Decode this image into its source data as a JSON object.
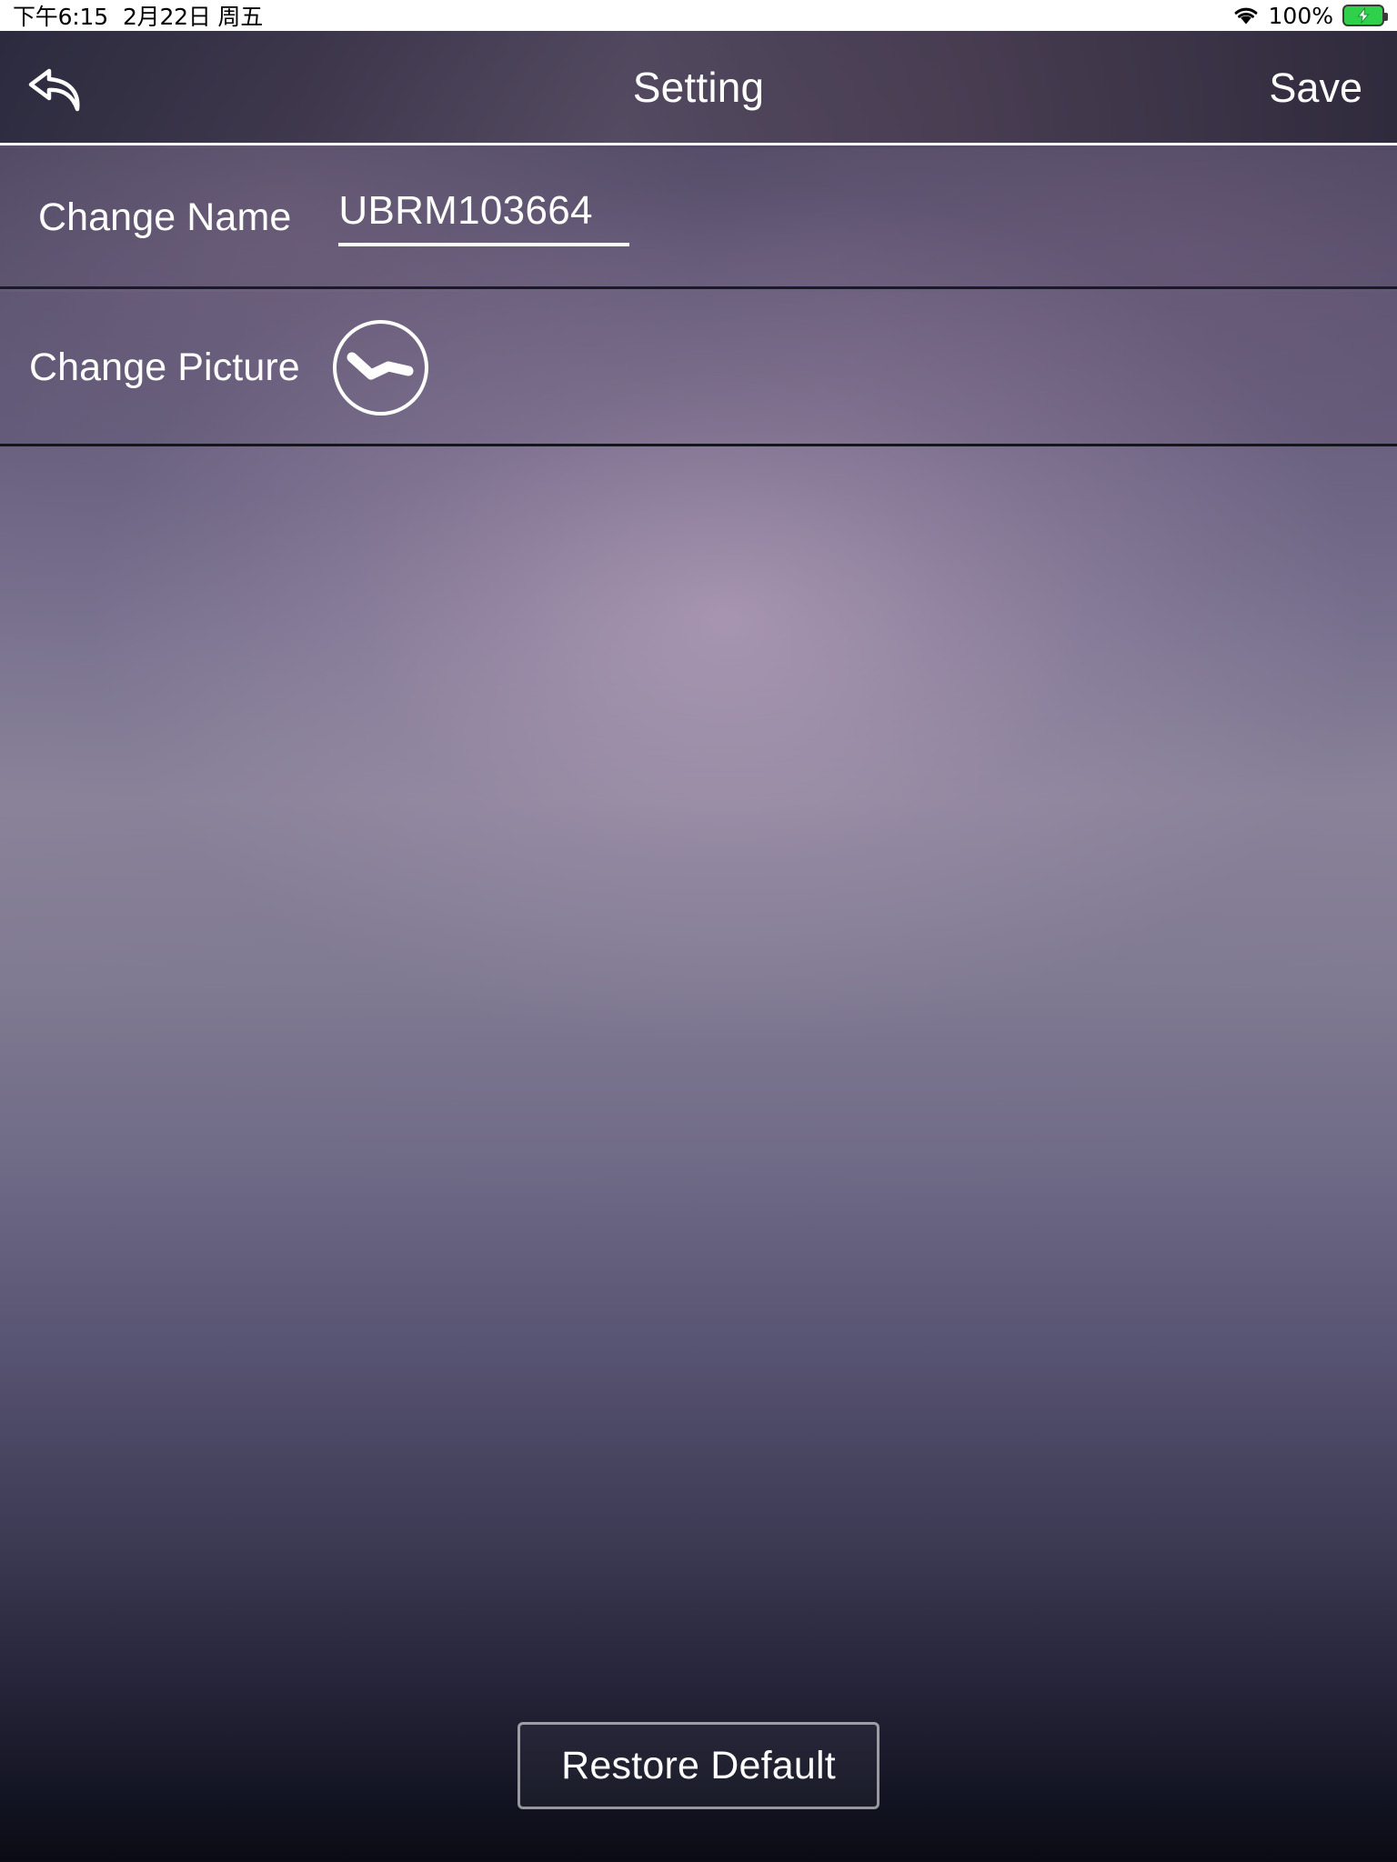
{
  "status_bar": {
    "time": "下午6:15",
    "date": "2月22日 周五",
    "battery_percent": "100%",
    "wifi_icon": "wifi-icon",
    "battery_icon": "battery-charging-icon",
    "battery_color": "#2fd14b"
  },
  "nav": {
    "title": "Setting",
    "back_icon": "back-arrow-icon",
    "save_label": "Save"
  },
  "rows": {
    "change_name": {
      "label": "Change Name",
      "value": "UBRM103664",
      "placeholder": "UBRM103664"
    },
    "change_picture": {
      "label": "Change Picture",
      "avatar_icon": "device-curve-icon"
    }
  },
  "footer": {
    "restore_label": "Restore Default"
  },
  "colors": {
    "text": "#ffffff",
    "separator": "#1a1a20",
    "status_bar_bg": "#ffffff"
  }
}
